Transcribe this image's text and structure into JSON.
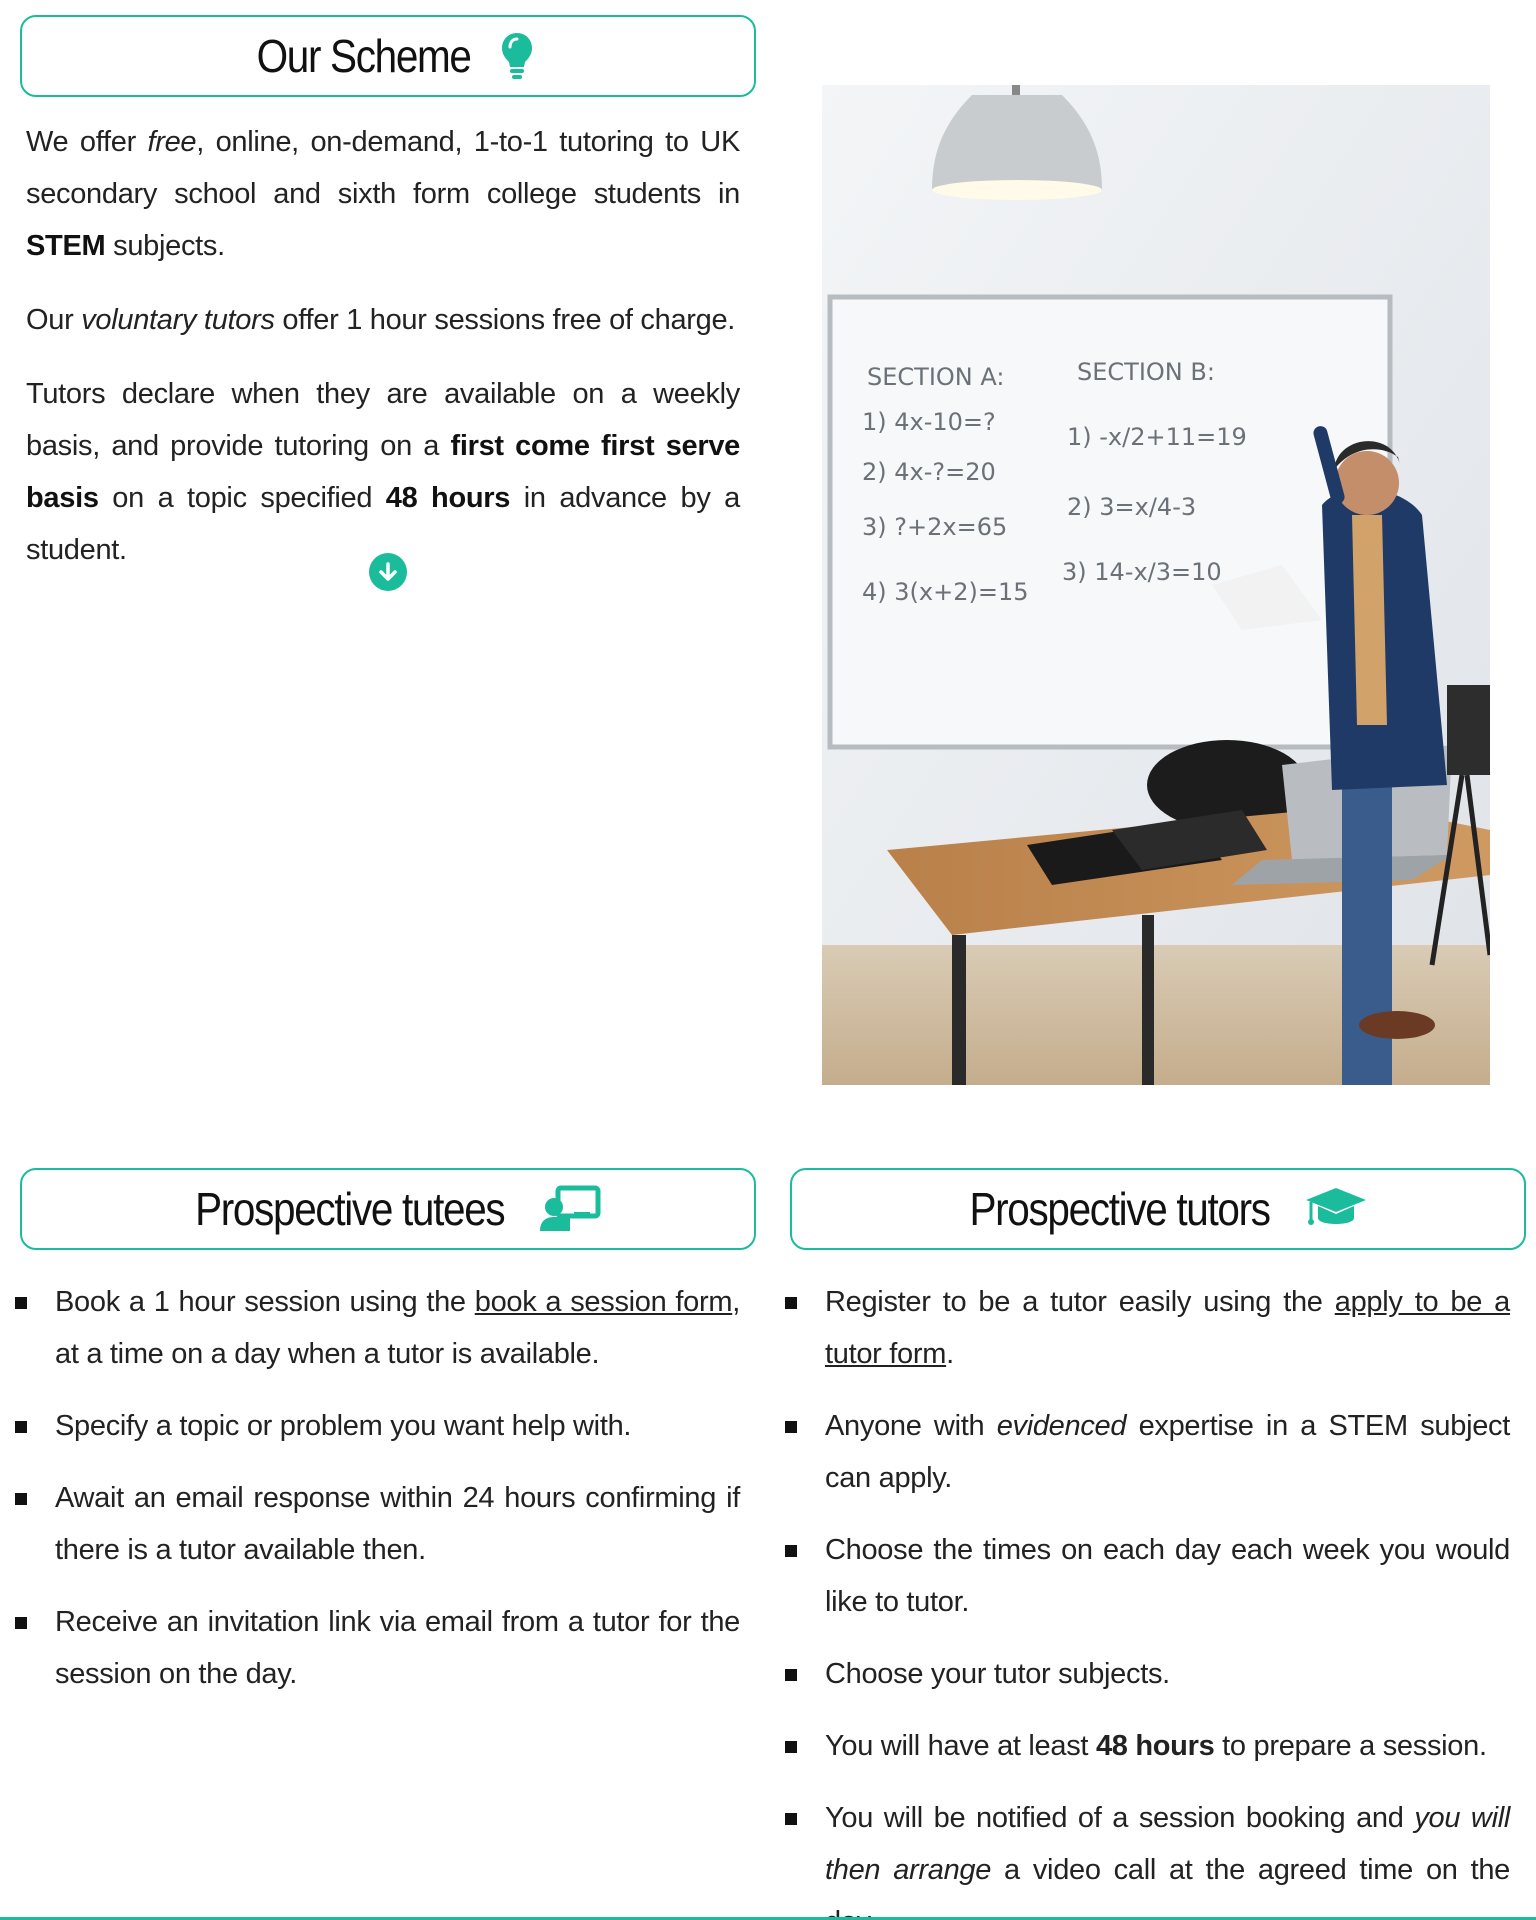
{
  "scheme": {
    "title": "Our Scheme",
    "icon": "lightbulb-icon",
    "p1": {
      "a": "We offer ",
      "free": "free",
      "b": ", online, on-demand, 1-to-1 tutoring to UK secondary school and sixth form college students in ",
      "stem": "STEM",
      "c": " subjects."
    },
    "p2": {
      "a": "Our ",
      "voluntary": "voluntary tutors",
      "b": " offer 1 hour sessions free of charge."
    },
    "p3": {
      "a": "Tutors declare when they are available on a weekly basis, and provide tutoring on a ",
      "fcfs": "first come first serve basis",
      "b": " on a topic specified ",
      "hours": "48 hours",
      "c": " in advance by a student."
    },
    "scroll_icon": "arrow-down-circle-icon"
  },
  "photo": {
    "board_section_a": "SECTION A:",
    "board_section_b": "SECTION B:",
    "board_a": [
      "1) 4x-10=?",
      "2) 4x-?=20",
      "3) ?+2x=65",
      "4) 3(x+2)=15"
    ],
    "board_b": [
      "1) -x/2+11=19",
      "2) 3=x/4-3",
      "3) 14-x/3=10"
    ]
  },
  "tutees": {
    "title": "Prospective tutees",
    "icon": "chalkboard-teacher-icon",
    "items": [
      {
        "a": "Book a 1 hour session using the ",
        "link": "book a session form",
        "b": ", at a time on a day when a tutor is available."
      },
      {
        "text": "Specify a topic or problem you want help with."
      },
      {
        "text": "Await an email response within 24 hours confirming if there is a tutor available then."
      },
      {
        "text": "Receive an invitation link via email from a tutor for the session on the day."
      }
    ]
  },
  "tutors": {
    "title": "Prospective tutors",
    "icon": "graduation-cap-icon",
    "items": [
      {
        "a": "Register to be a tutor easily using the ",
        "link": "apply to be a tutor form",
        "b": "."
      },
      {
        "a": "Anyone with ",
        "em": "evidenced",
        "b": " expertise in a STEM subject can apply."
      },
      {
        "text": "Choose the times on each day each week you would like to tutor."
      },
      {
        "text": "Choose your tutor subjects."
      },
      {
        "a": "You will have at least ",
        "bold": "48 hours",
        "b": " to prepare a session."
      },
      {
        "a": "You will be notified of a session booking and ",
        "em": "you will then arrange",
        "b": " a video call at the agreed time on the day."
      }
    ]
  },
  "colors": {
    "accent": "#1abc9c",
    "text": "#222222"
  }
}
